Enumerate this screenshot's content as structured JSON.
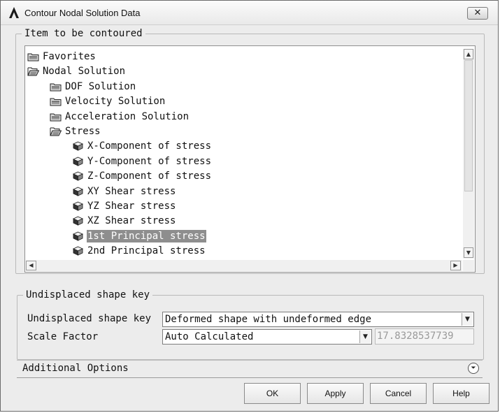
{
  "window": {
    "title": "Contour Nodal Solution Data",
    "close_symbol": "✕"
  },
  "item_group": {
    "legend": "Item to be contoured",
    "tree": [
      {
        "label": "Favorites",
        "icon": "closed-folder-icon",
        "level": 0,
        "selected": false
      },
      {
        "label": "Nodal Solution",
        "icon": "open-folder-icon",
        "level": 0,
        "selected": false
      },
      {
        "label": "DOF Solution",
        "icon": "closed-folder-icon",
        "level": 1,
        "selected": false
      },
      {
        "label": "Velocity Solution",
        "icon": "closed-folder-icon",
        "level": 1,
        "selected": false
      },
      {
        "label": "Acceleration Solution",
        "icon": "closed-folder-icon",
        "level": 1,
        "selected": false
      },
      {
        "label": "Stress",
        "icon": "open-folder-icon",
        "level": 1,
        "selected": false
      },
      {
        "label": "X-Component of stress",
        "icon": "cube-icon",
        "level": 2,
        "selected": false
      },
      {
        "label": "Y-Component of stress",
        "icon": "cube-icon",
        "level": 2,
        "selected": false
      },
      {
        "label": "Z-Component of stress",
        "icon": "cube-icon",
        "level": 2,
        "selected": false
      },
      {
        "label": "XY Shear stress",
        "icon": "cube-icon",
        "level": 2,
        "selected": false
      },
      {
        "label": "YZ Shear stress",
        "icon": "cube-icon",
        "level": 2,
        "selected": false
      },
      {
        "label": "XZ Shear stress",
        "icon": "cube-icon",
        "level": 2,
        "selected": false
      },
      {
        "label": "1st Principal stress",
        "icon": "cube-icon",
        "level": 2,
        "selected": true
      },
      {
        "label": "2nd Principal stress",
        "icon": "cube-icon",
        "level": 2,
        "selected": false
      }
    ]
  },
  "shape_group": {
    "legend": "Undisplaced shape key",
    "undisplaced_label": "Undisplaced shape key",
    "undisplaced_value": "Deformed shape with undeformed edge",
    "scale_label": "Scale Factor",
    "scale_value": "Auto Calculated",
    "scale_number": "17.8328537739"
  },
  "additional_options": {
    "label": "Additional Options"
  },
  "buttons": {
    "ok": "OK",
    "apply": "Apply",
    "cancel": "Cancel",
    "help": "Help"
  }
}
